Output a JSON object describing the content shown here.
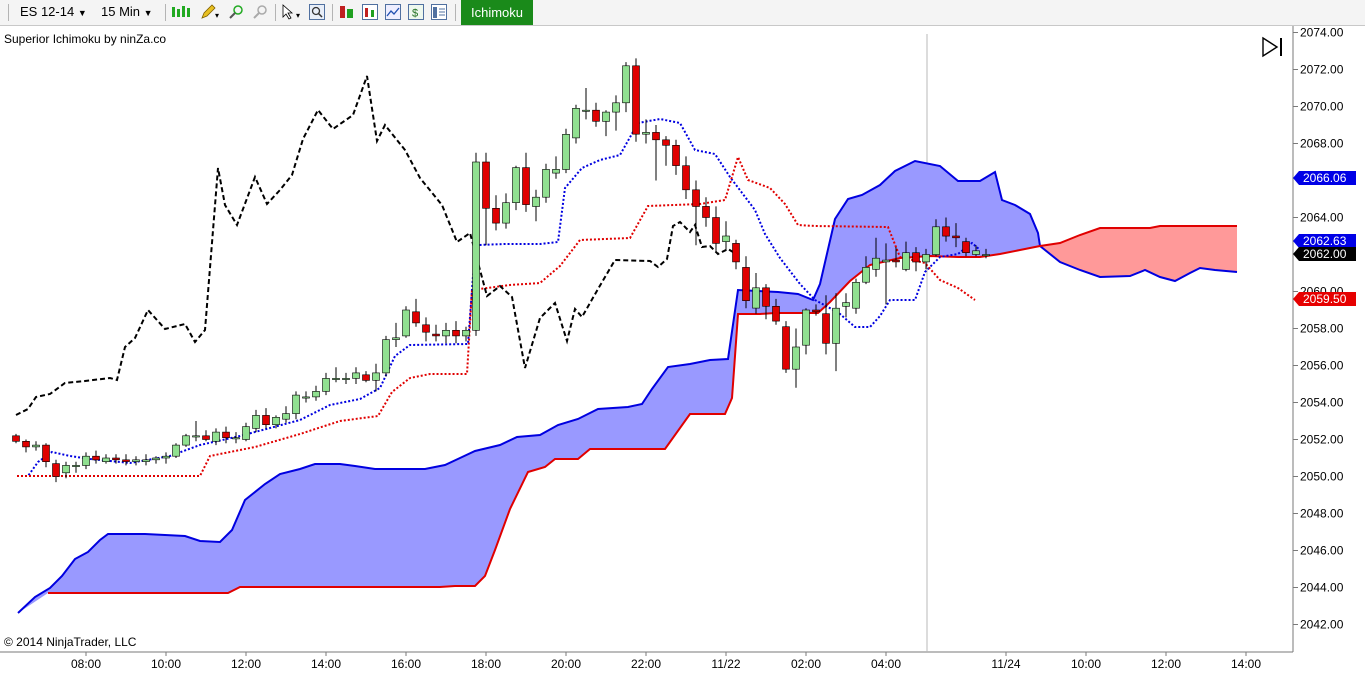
{
  "toolbar": {
    "instrument": "ES 12-14",
    "interval": "15 Min",
    "active_tab": "Ichimoku"
  },
  "chart": {
    "indicator_label": "Superior Ichimoku by ninZa.co",
    "copyright": "© 2014 NinjaTrader, LLC",
    "time_labels": [
      "08:00",
      "10:00",
      "12:00",
      "14:00",
      "16:00",
      "18:00",
      "20:00",
      "22:00",
      "11/22",
      "02:00",
      "04:00",
      "11/24",
      "10:00",
      "12:00",
      "14:00"
    ],
    "price_labels": [
      "2074.00",
      "2072.00",
      "2070.00",
      "2068.00",
      "2064.00",
      "2060.00",
      "2058.00",
      "2056.00",
      "2054.00",
      "2052.00",
      "2050.00",
      "2048.00",
      "2046.00",
      "2044.00",
      "2042.00"
    ],
    "price_markers": [
      {
        "value": "2066.06",
        "color": "#0000e6"
      },
      {
        "value": "2062.63",
        "color": "#0000e6"
      },
      {
        "value": "2062.00",
        "color": "#000000"
      },
      {
        "value": "2059.50",
        "color": "#e60000"
      }
    ]
  },
  "colors": {
    "up_candle": "#90e090",
    "down_candle": "#e00000",
    "tenkan": "#0000e0",
    "kijun": "#e00000",
    "chikou": "#000000",
    "kumo_bull": "#9999ff",
    "kumo_bear": "#ff9999",
    "active_tab": "#1a8a1a"
  }
}
